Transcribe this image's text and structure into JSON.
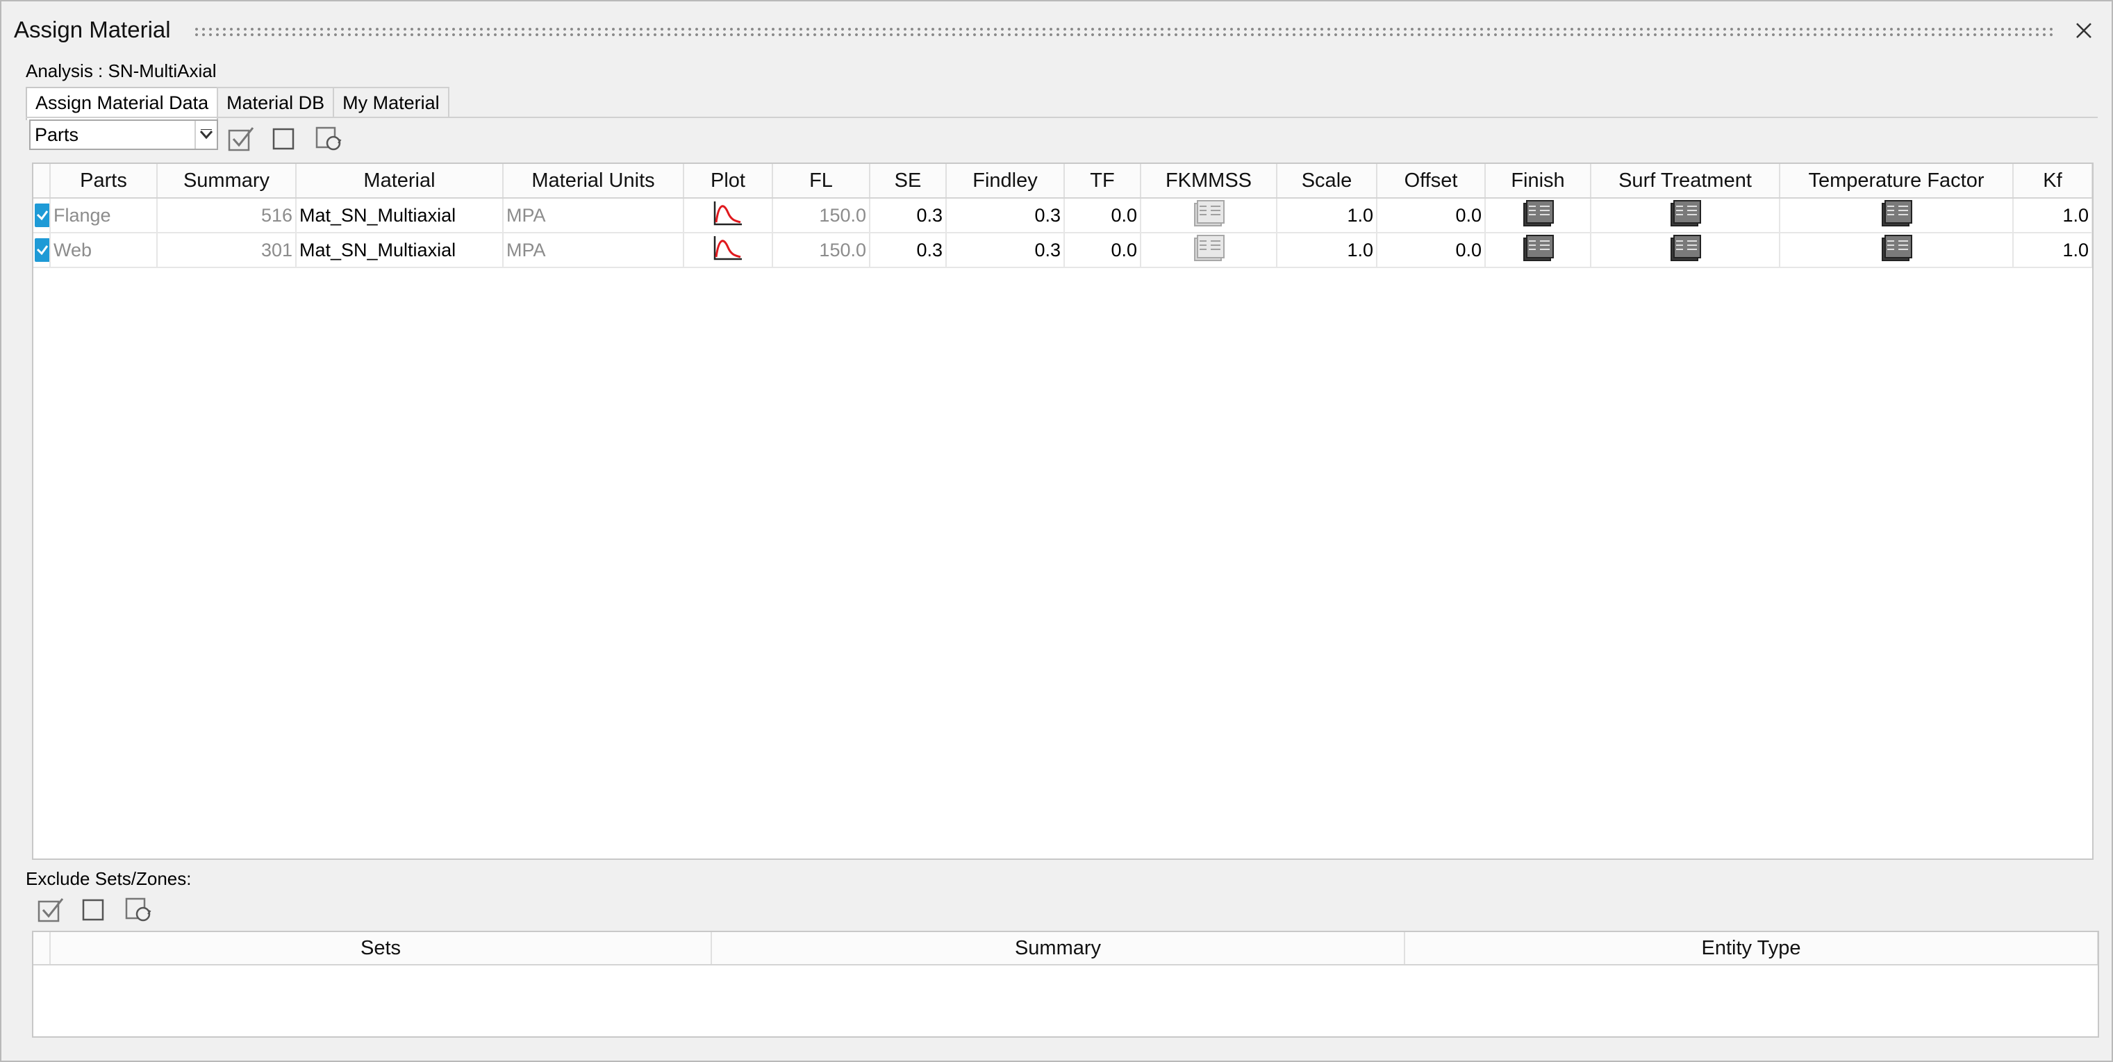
{
  "window": {
    "title": "Assign Material",
    "close_icon": "close-icon"
  },
  "analysis_label": "Analysis : SN-MultiAxial",
  "tabs": [
    {
      "label": "Assign Material Data",
      "active": true
    },
    {
      "label": "Material DB",
      "active": false
    },
    {
      "label": "My Material",
      "active": false
    }
  ],
  "toolbar": {
    "entity_select": {
      "value": "Parts"
    },
    "icons": [
      "check-all-icon",
      "uncheck-all-icon",
      "refresh-icon"
    ]
  },
  "materials_table": {
    "headers": [
      "Parts",
      "Summary",
      "Material",
      "Material Units",
      "Plot",
      "FL",
      "SE",
      "Findley",
      "TF",
      "FKMMSS",
      "Scale",
      "Offset",
      "Finish",
      "Surf Treatment",
      "Temperature Factor",
      "Kf"
    ],
    "rows": [
      {
        "checked": true,
        "part": "Flange",
        "summary": "516",
        "material": "Mat_SN_Multiaxial",
        "units": "MPA",
        "fl": "150.0",
        "se": "0.3",
        "findley": "0.3",
        "tf": "0.0",
        "scale": "1.0",
        "offset": "0.0",
        "kf": "1.0"
      },
      {
        "checked": true,
        "part": "Web",
        "summary": "301",
        "material": "Mat_SN_Multiaxial",
        "units": "MPA",
        "fl": "150.0",
        "se": "0.3",
        "findley": "0.3",
        "tf": "0.0",
        "scale": "1.0",
        "offset": "0.0",
        "kf": "1.0"
      }
    ]
  },
  "exclude": {
    "label": "Exclude Sets/Zones:",
    "headers": [
      "Sets",
      "Summary",
      "Entity Type"
    ],
    "rows": []
  },
  "colors": {
    "accent": "#1e9ad6",
    "plot_curve": "#e0191e"
  }
}
